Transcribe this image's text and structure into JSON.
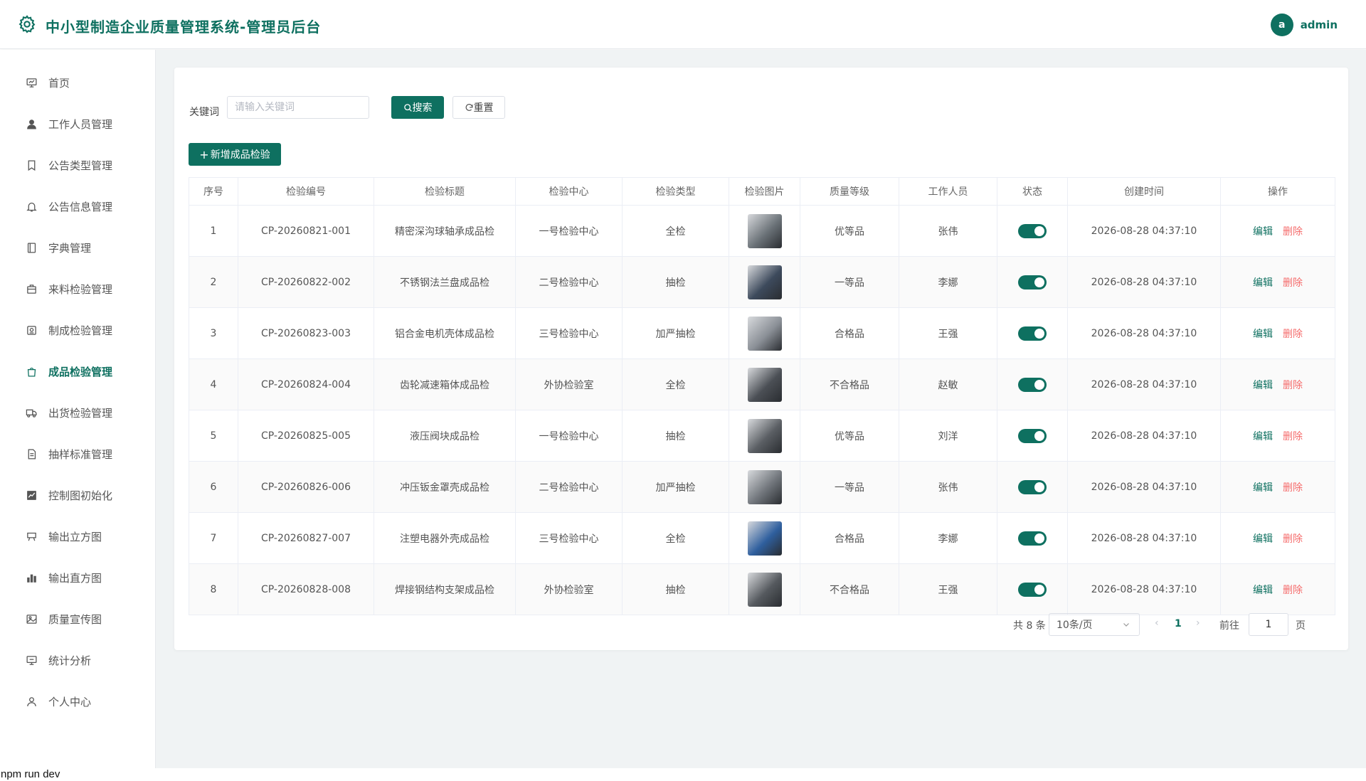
{
  "header": {
    "title": "中小型制造企业质量管理系统-管理员后台",
    "avatar_letter": "a",
    "username": "admin",
    "accent": "#0e7060"
  },
  "sidebar": {
    "items": [
      {
        "label": "首页",
        "icon": "dashboard-icon"
      },
      {
        "label": "工作人员管理",
        "icon": "user-icon"
      },
      {
        "label": "公告类型管理",
        "icon": "bookmark-icon"
      },
      {
        "label": "公告信息管理",
        "icon": "bell-icon"
      },
      {
        "label": "字典管理",
        "icon": "book-icon"
      },
      {
        "label": "来料检验管理",
        "icon": "package-icon"
      },
      {
        "label": "制成检验管理",
        "icon": "cog-box-icon"
      },
      {
        "label": "成品检验管理",
        "icon": "shopping-bag-icon",
        "active": true
      },
      {
        "label": "出货检验管理",
        "icon": "truck-icon"
      },
      {
        "label": "抽样标准管理",
        "icon": "document-icon"
      },
      {
        "label": "控制图初始化",
        "icon": "line-chart-icon"
      },
      {
        "label": "输出立方图",
        "icon": "cart-icon"
      },
      {
        "label": "输出直方图",
        "icon": "bar-chart-icon"
      },
      {
        "label": "质量宣传图",
        "icon": "picture-icon"
      },
      {
        "label": "统计分析",
        "icon": "stats-icon"
      },
      {
        "label": "个人中心",
        "icon": "person-icon"
      }
    ]
  },
  "search": {
    "label": "关键词",
    "placeholder": "请输入关键词",
    "value": "",
    "search_label": "搜索",
    "reset_label": "重置"
  },
  "toolbar": {
    "add_label": "新增成品检验"
  },
  "table": {
    "columns": [
      "序号",
      "检验编号",
      "检验标题",
      "检验中心",
      "检验类型",
      "检验图片",
      "质量等级",
      "工作人员",
      "状态",
      "创建时间",
      "操作"
    ],
    "edit_label": "编辑",
    "delete_label": "删除",
    "rows": [
      {
        "index": "1",
        "code": "CP-20260821-001",
        "title": "精密深沟球轴承成品检",
        "center": "一号检验中心",
        "type": "全检",
        "thumb_color": "#6b7278",
        "grade": "优等品",
        "staff": "张伟",
        "status": true,
        "created": "2026-08-28 04:37:10"
      },
      {
        "index": "2",
        "code": "CP-20260822-002",
        "title": "不锈钢法兰盘成品检",
        "center": "二号检验中心",
        "type": "抽检",
        "thumb_color": "#3d4a5c",
        "grade": "一等品",
        "staff": "李娜",
        "status": true,
        "created": "2026-08-28 04:37:10"
      },
      {
        "index": "3",
        "code": "CP-20260823-003",
        "title": "铝合金电机壳体成品检",
        "center": "三号检验中心",
        "type": "加严抽检",
        "thumb_color": "#8a8f96",
        "grade": "合格品",
        "staff": "王强",
        "status": true,
        "created": "2026-08-28 04:37:10"
      },
      {
        "index": "4",
        "code": "CP-20260824-004",
        "title": "齿轮减速箱体成品检",
        "center": "外协检验室",
        "type": "全检",
        "thumb_color": "#4b4f55",
        "grade": "不合格品",
        "staff": "赵敏",
        "status": true,
        "created": "2026-08-28 04:37:10"
      },
      {
        "index": "5",
        "code": "CP-20260825-005",
        "title": "液压阀块成品检",
        "center": "一号检验中心",
        "type": "抽检",
        "thumb_color": "#5a5e63",
        "grade": "优等品",
        "staff": "刘洋",
        "status": true,
        "created": "2026-08-28 04:37:10"
      },
      {
        "index": "6",
        "code": "CP-20260826-006",
        "title": "冲压钣金罩壳成品检",
        "center": "二号检验中心",
        "type": "加严抽检",
        "thumb_color": "#70757b",
        "grade": "一等品",
        "staff": "张伟",
        "status": true,
        "created": "2026-08-28 04:37:10"
      },
      {
        "index": "7",
        "code": "CP-20260827-007",
        "title": "注塑电器外壳成品检",
        "center": "三号检验中心",
        "type": "全检",
        "thumb_color": "#2f5f9e",
        "grade": "合格品",
        "staff": "李娜",
        "status": true,
        "created": "2026-08-28 04:37:10"
      },
      {
        "index": "8",
        "code": "CP-20260828-008",
        "title": "焊接钢结构支架成品检",
        "center": "外协检验室",
        "type": "抽检",
        "thumb_color": "#55595e",
        "grade": "不合格品",
        "staff": "王强",
        "status": true,
        "created": "2026-08-28 04:37:10"
      }
    ]
  },
  "pagination": {
    "total_text": "共 8 条",
    "page_size": "10条/页",
    "current_page": "1",
    "goto_label": "前往",
    "goto_value": "1",
    "page_unit": "页"
  },
  "terminal": {
    "text": "npm run dev"
  }
}
